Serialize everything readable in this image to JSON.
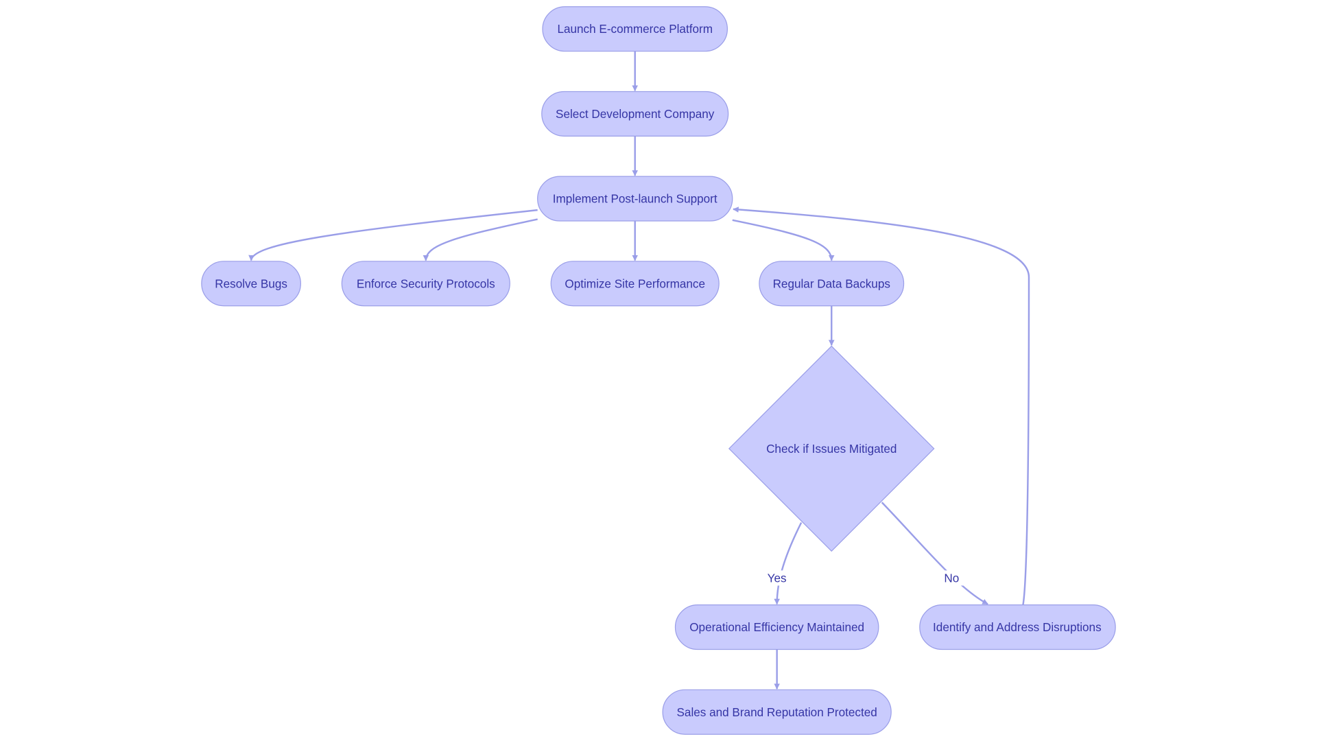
{
  "colors": {
    "node_fill": "#c9cbfd",
    "node_stroke": "#9a9ee8",
    "text": "#3535a5",
    "edge": "#9a9ee8"
  },
  "nodes": {
    "launch": "Launch E-commerce Platform",
    "select": "Select Development Company",
    "implement": "Implement Post-launch Support",
    "bugs": "Resolve Bugs",
    "security": "Enforce Security Protocols",
    "performance": "Optimize Site Performance",
    "backups": "Regular Data Backups",
    "check": "Check if Issues Mitigated",
    "efficiency": "Operational Efficiency Maintained",
    "identify": "Identify and Address Disruptions",
    "sales": "Sales and Brand Reputation Protected"
  },
  "edges": [
    {
      "from": "launch",
      "to": "select"
    },
    {
      "from": "select",
      "to": "implement"
    },
    {
      "from": "implement",
      "to": "bugs"
    },
    {
      "from": "implement",
      "to": "security"
    },
    {
      "from": "implement",
      "to": "performance"
    },
    {
      "from": "implement",
      "to": "backups"
    },
    {
      "from": "backups",
      "to": "check"
    },
    {
      "from": "check",
      "to": "efficiency",
      "label": "Yes"
    },
    {
      "from": "check",
      "to": "identify",
      "label": "No"
    },
    {
      "from": "identify",
      "to": "implement"
    },
    {
      "from": "efficiency",
      "to": "sales"
    }
  ]
}
